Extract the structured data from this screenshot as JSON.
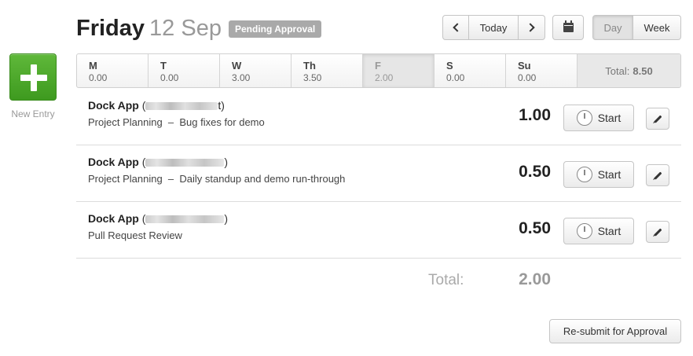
{
  "sidebar": {
    "new_entry_label": "New Entry"
  },
  "header": {
    "day_name": "Friday",
    "date": "12 Sep",
    "status": "Pending Approval",
    "nav": {
      "today_label": "Today"
    },
    "view": {
      "day_label": "Day",
      "week_label": "Week",
      "active": "Day"
    }
  },
  "week": {
    "days": [
      {
        "abbr": "M",
        "hours": "0.00",
        "selected": false
      },
      {
        "abbr": "T",
        "hours": "0.00",
        "selected": false
      },
      {
        "abbr": "W",
        "hours": "3.00",
        "selected": false
      },
      {
        "abbr": "Th",
        "hours": "3.50",
        "selected": false
      },
      {
        "abbr": "F",
        "hours": "2.00",
        "selected": true
      },
      {
        "abbr": "S",
        "hours": "0.00",
        "selected": false
      },
      {
        "abbr": "Su",
        "hours": "0.00",
        "selected": false
      }
    ],
    "total_label": "Total:",
    "total_value": "8.50"
  },
  "entries": [
    {
      "project": "Dock App",
      "client_visible": "t",
      "task": "Project Planning",
      "notes": "Bug fixes for demo",
      "hours": "1.00",
      "start_label": "Start"
    },
    {
      "project": "Dock App",
      "client_visible": "",
      "task": "Project Planning",
      "notes": "Daily standup and demo run-through",
      "hours": "0.50",
      "start_label": "Start"
    },
    {
      "project": "Dock App",
      "client_visible": "",
      "task": "Pull Request Review",
      "notes": "",
      "hours": "0.50",
      "start_label": "Start"
    }
  ],
  "day_total": {
    "label": "Total:",
    "value": "2.00"
  },
  "footer": {
    "resubmit_label": "Re-submit for Approval"
  },
  "colors": {
    "new_entry_green": "#4aa82a",
    "status_badge": "#a9a9a9"
  }
}
